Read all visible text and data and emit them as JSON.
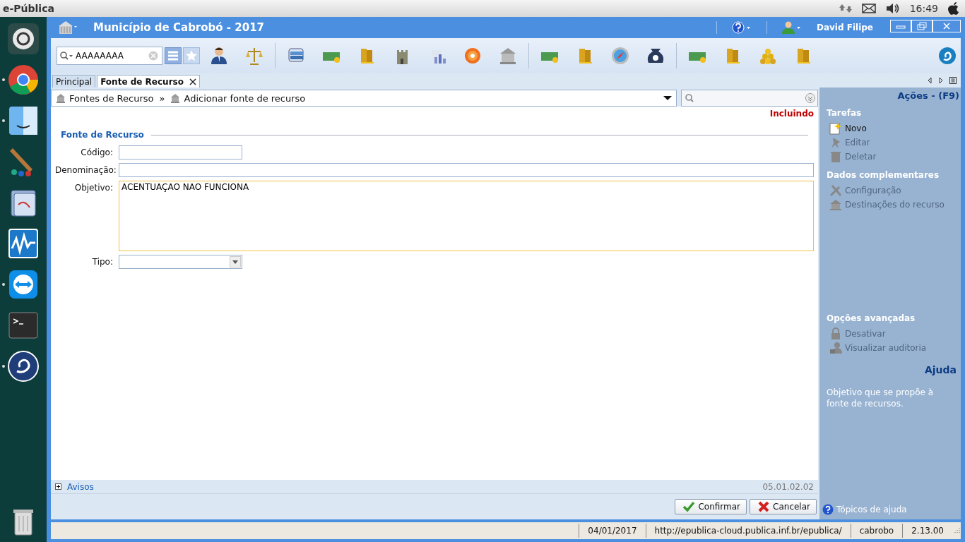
{
  "desktop_bar": {
    "app_name": "e-Pública",
    "clock": "16:49"
  },
  "dock": [
    {
      "kind": "ubuntu",
      "running": false
    },
    {
      "kind": "chrome",
      "running": true
    },
    {
      "kind": "finder",
      "running": true
    },
    {
      "kind": "brush",
      "running": false
    },
    {
      "kind": "files",
      "running": false
    },
    {
      "kind": "monitor",
      "running": false
    },
    {
      "kind": "teamviewer",
      "running": true
    },
    {
      "kind": "terminal",
      "running": false
    },
    {
      "kind": "epublica",
      "running": true
    },
    {
      "kind": "trash",
      "running": false
    }
  ],
  "window": {
    "title": "Município de Cabrobó - 2017",
    "user_name": "David Filipe"
  },
  "search": {
    "value": "AAAAAAAA"
  },
  "tabs": [
    {
      "label": "Principal",
      "selected": false,
      "closable": false
    },
    {
      "label": "Fonte de Recurso",
      "selected": true,
      "closable": true
    }
  ],
  "breadcrumb": {
    "items": [
      "Fontes de Recurso",
      "Adicionar fonte de recurso"
    ],
    "separator": "»"
  },
  "mode": "Incluindo",
  "form": {
    "section_title": "Fonte de Recurso",
    "fields": [
      {
        "kind": "text",
        "label": "Código:",
        "focused": false
      },
      {
        "kind": "text",
        "label": "Denominação:",
        "focused": false
      },
      {
        "kind": "textarea",
        "label": "Objetivo:",
        "value": "ACENTUAÇAO NAO FUNCIONA",
        "focused": true
      },
      {
        "kind": "select",
        "label": "Tipo:",
        "focused": false
      }
    ]
  },
  "avisos": {
    "label": "Avisos",
    "expanded": false,
    "version": "05.01.02.02"
  },
  "buttons": [
    {
      "kind": "confirm",
      "label": "Confirmar"
    },
    {
      "kind": "cancel",
      "label": "Cancelar"
    }
  ],
  "actions": {
    "title": "Ações - (F9)",
    "groups": [
      {
        "title": "Tarefas",
        "items": [
          {
            "label": "Novo",
            "disabled": false
          },
          {
            "label": "Editar",
            "disabled": true
          },
          {
            "label": "Deletar",
            "disabled": true
          }
        ]
      },
      {
        "title": "Dados complementares",
        "items": [
          {
            "label": "Configuração",
            "disabled": true
          },
          {
            "label": "Destinações do recurso",
            "disabled": true
          }
        ]
      }
    ],
    "advanced": {
      "title": "Opções avançadas",
      "items": [
        {
          "label": "Desativar",
          "disabled": true
        },
        {
          "label": "Visualizar auditoria",
          "disabled": true
        }
      ]
    },
    "help": {
      "title": "Ajuda",
      "text": "Objetivo que se propõe à fonte de recursos.",
      "link": "Tópicos de ajuda"
    }
  },
  "status_bar": [
    "04/01/2017",
    "http://epublica-cloud.publica.inf.br/epublica/",
    "cabrobo",
    "2.13.00"
  ]
}
